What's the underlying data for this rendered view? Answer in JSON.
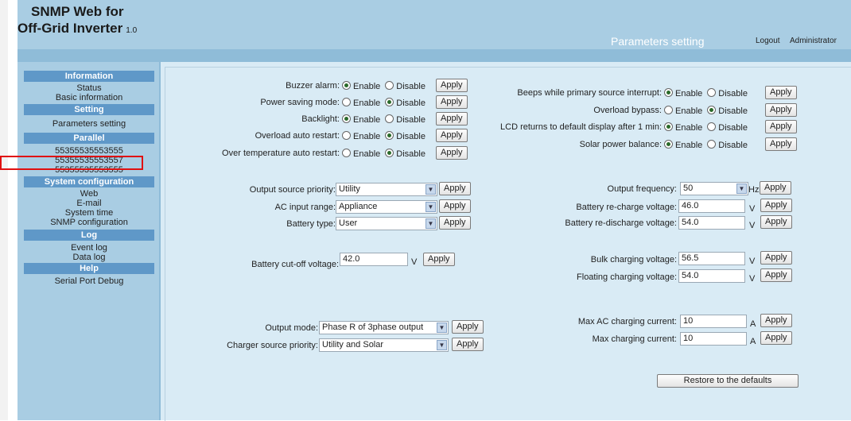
{
  "header": {
    "title_line1": "SNMP Web for",
    "title_line2": "Off-Grid Inverter",
    "version": "1.0",
    "page_heading": "Parameters setting",
    "logout": "Logout",
    "user": "Administrator"
  },
  "sidebar": {
    "sections": [
      {
        "title": "Information",
        "items": [
          "Status",
          "Basic information"
        ]
      },
      {
        "title": "Setting",
        "items": [
          "Parameters setting"
        ]
      },
      {
        "title": "Parallel",
        "items": [
          "55355535553555",
          "55355535553557",
          "55355535553555"
        ]
      },
      {
        "title": "System configuration",
        "items": [
          "Web",
          "E-mail",
          "System time",
          "SNMP configuration"
        ]
      },
      {
        "title": "Log",
        "items": [
          "Event log",
          "Data log"
        ]
      },
      {
        "title": "Help",
        "items": [
          "Serial Port Debug"
        ]
      }
    ]
  },
  "radio_options": {
    "enable": "Enable",
    "disable": "Disable"
  },
  "apply_label": "Apply",
  "left_toggles": [
    {
      "label": "Buzzer alarm:",
      "value": "Enable"
    },
    {
      "label": "Power saving mode:",
      "value": "Disable"
    },
    {
      "label": "Backlight:",
      "value": "Enable"
    },
    {
      "label": "Overload auto restart:",
      "value": "Disable"
    },
    {
      "label": "Over temperature auto restart:",
      "value": "Disable"
    }
  ],
  "right_toggles": [
    {
      "label": "Beeps while primary source interrupt:",
      "value": "Enable"
    },
    {
      "label": "Overload bypass:",
      "value": "Disable"
    },
    {
      "label": "LCD returns to default display after 1 min:",
      "value": "Enable"
    },
    {
      "label": "Solar power balance:",
      "value": "Enable"
    }
  ],
  "left_selects": [
    {
      "label": "Output source priority:",
      "value": "Utility"
    },
    {
      "label": "AC input range:",
      "value": "Appliance"
    },
    {
      "label": "Battery type:",
      "value": "User"
    }
  ],
  "battery_cutoff": {
    "label": "Battery cut-off voltage:",
    "value": "42.0",
    "unit": "V"
  },
  "right_values": [
    {
      "label": "Output frequency:",
      "value": "50",
      "unit": "Hz"
    },
    {
      "label": "Battery re-charge voltage:",
      "value": "46.0",
      "unit": "V"
    },
    {
      "label": "Battery re-discharge voltage:",
      "value": "54.0",
      "unit": "V"
    },
    {
      "label": "Bulk charging voltage:",
      "value": "56.5",
      "unit": "V"
    },
    {
      "label": "Floating charging voltage:",
      "value": "54.0",
      "unit": "V"
    },
    {
      "label": "Max AC charging current:",
      "value": "10",
      "unit": "A"
    },
    {
      "label": "Max charging current:",
      "value": "10",
      "unit": "A"
    }
  ],
  "bottom_selects": [
    {
      "label": "Output mode:",
      "value": "Phase R of 3phase output"
    },
    {
      "label": "Charger source priority:",
      "value": "Utility and Solar"
    }
  ],
  "restore_label": "Restore to the defaults"
}
